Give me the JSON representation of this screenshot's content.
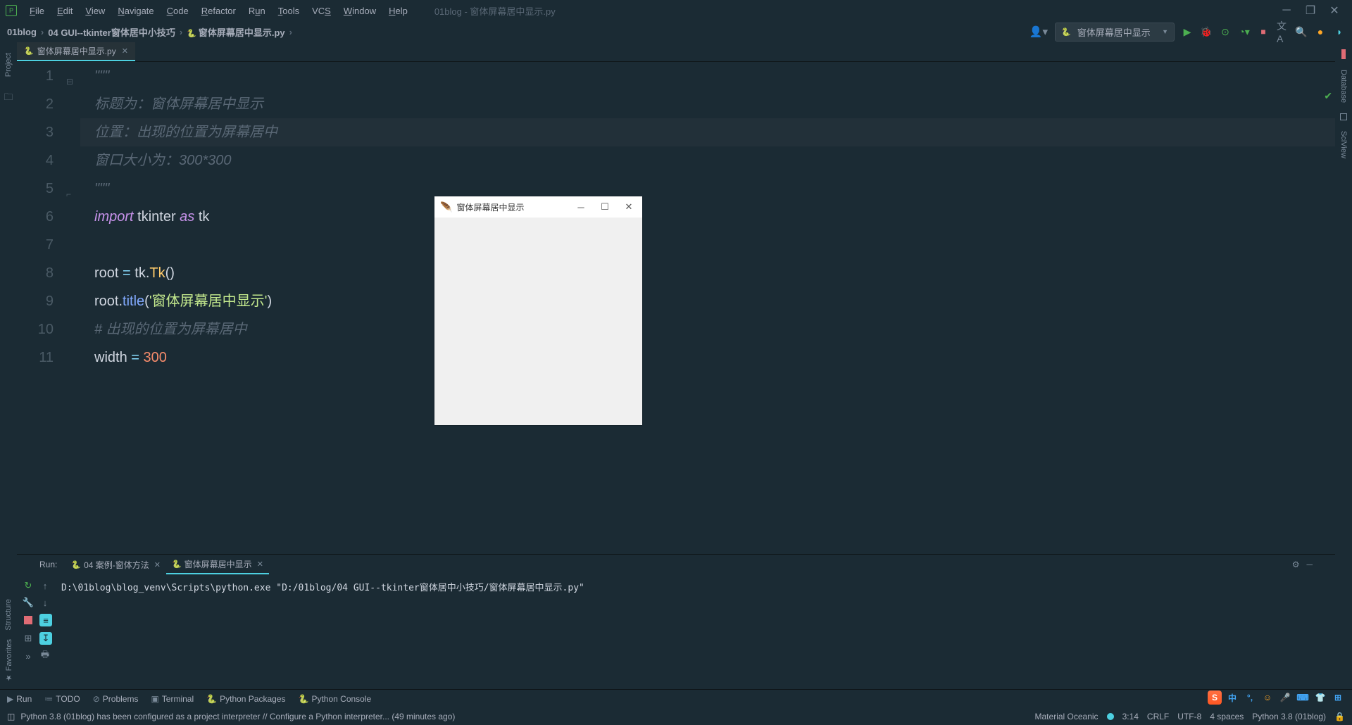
{
  "window": {
    "title": "01blog - 窗体屏幕居中显示.py"
  },
  "menu": {
    "file": "File",
    "edit": "Edit",
    "view": "View",
    "navigate": "Navigate",
    "code": "Code",
    "refactor": "Refactor",
    "run": "Run",
    "tools": "Tools",
    "vcs": "VCS",
    "window": "Window",
    "help": "Help"
  },
  "breadcrumb": {
    "project": "01blog",
    "folder": "04 GUI--tkinter窗体居中小技巧",
    "file": "窗体屏幕居中显示.py"
  },
  "run_config": {
    "name": "窗体屏幕居中显示"
  },
  "editor_tab": {
    "name": "窗体屏幕居中显示.py"
  },
  "code_lines": {
    "l1": "\"\"\"",
    "l2": "标题为：窗体屏幕居中显示",
    "l3": "位置：出现的位置为屏幕居中",
    "l4": "窗口大小为：300*300",
    "l5": "\"\"\"",
    "l6a": "import",
    "l6b": " tkinter ",
    "l6c": "as",
    "l6d": " tk",
    "l8a": "root ",
    "l8b": "=",
    "l8c": " tk.",
    "l8d": "Tk",
    "l8e": "()",
    "l9a": "root.",
    "l9b": "title",
    "l9c": "(",
    "l9d": "'窗体屏幕居中显示'",
    "l9e": ")",
    "l10": "# 出现的位置为屏幕居中",
    "l11a": "width ",
    "l11b": "=",
    "l11c": " ",
    "l11d": "300"
  },
  "line_numbers": [
    "1",
    "2",
    "3",
    "4",
    "5",
    "6",
    "7",
    "8",
    "9",
    "10",
    "11"
  ],
  "run_panel": {
    "label": "Run:",
    "tabs": [
      {
        "name": "04 案例-窗体方法",
        "active": false
      },
      {
        "name": "窗体屏幕居中显示",
        "active": true
      }
    ],
    "console": "D:\\01blog\\blog_venv\\Scripts\\python.exe \"D:/01blog/04 GUI--tkinter窗体居中小技巧/窗体屏幕居中显示.py\""
  },
  "bottom_tools": {
    "run": "Run",
    "todo": "TODO",
    "problems": "Problems",
    "terminal": "Terminal",
    "packages": "Python Packages",
    "console": "Python Console"
  },
  "side_tools": {
    "project": "Project",
    "structure": "Structure",
    "favorites": "Favorites",
    "database": "Database",
    "sciview": "SciView"
  },
  "status": {
    "message": "Python 3.8 (01blog) has been configured as a project interpreter // Configure a Python interpreter... (49 minutes ago)",
    "theme": "Material Oceanic",
    "cursor": "3:14",
    "eol": "CRLF",
    "encoding": "UTF-8",
    "indent": "4 spaces",
    "interpreter": "Python 3.8 (01blog)"
  },
  "tk_window": {
    "title": "窗体屏幕居中显示"
  },
  "ime": {
    "s": "S",
    "cn": "中"
  }
}
